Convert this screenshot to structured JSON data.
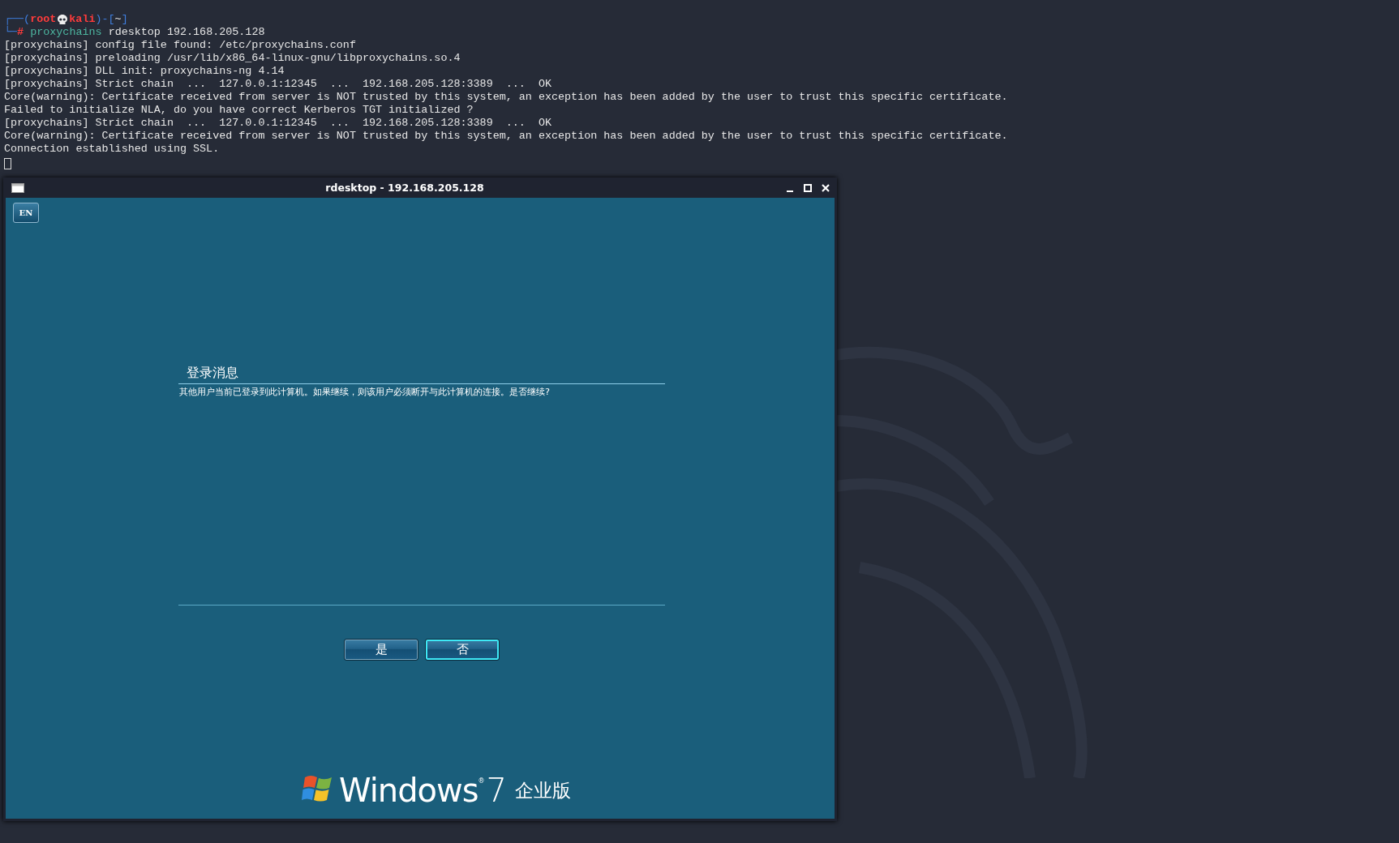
{
  "terminal": {
    "prompt": {
      "open": "┌──(",
      "user": "root",
      "host": "kali",
      "mid": ")-[",
      "dir": "~",
      "close": "]",
      "corner": "└─",
      "hash": "#",
      "command": "proxychains",
      "args": "rdesktop 192.168.205.128"
    },
    "lines": [
      "[proxychains] config file found: /etc/proxychains.conf",
      "[proxychains] preloading /usr/lib/x86_64-linux-gnu/libproxychains.so.4",
      "[proxychains] DLL init: proxychains-ng 4.14",
      "[proxychains] Strict chain  ...  127.0.0.1:12345  ...  192.168.205.128:3389  ...  OK",
      "Core(warning): Certificate received from server is NOT trusted by this system, an exception has been added by the user to trust this specific certificate.",
      "Failed to initialize NLA, do you have correct Kerberos TGT initialized ?",
      "[proxychains] Strict chain  ...  127.0.0.1:12345  ...  192.168.205.128:3389  ...  OK",
      "Core(warning): Certificate received from server is NOT trusted by this system, an exception has been added by the user to trust this specific certificate.",
      "Connection established using SSL."
    ]
  },
  "window": {
    "title": "rdesktop - 192.168.205.128",
    "language_button": "EN",
    "dialog": {
      "title": "登录消息",
      "message": "其他用户当前已登录到此计算机。如果继续，则该用户必须断开与此计算机的连接。是否继续?",
      "buttons": [
        {
          "label": "是",
          "selected": false
        },
        {
          "label": "否",
          "selected": true
        }
      ]
    },
    "logo": {
      "word": "Windows",
      "mark": "®",
      "version": "7",
      "edition": "企业版"
    }
  }
}
